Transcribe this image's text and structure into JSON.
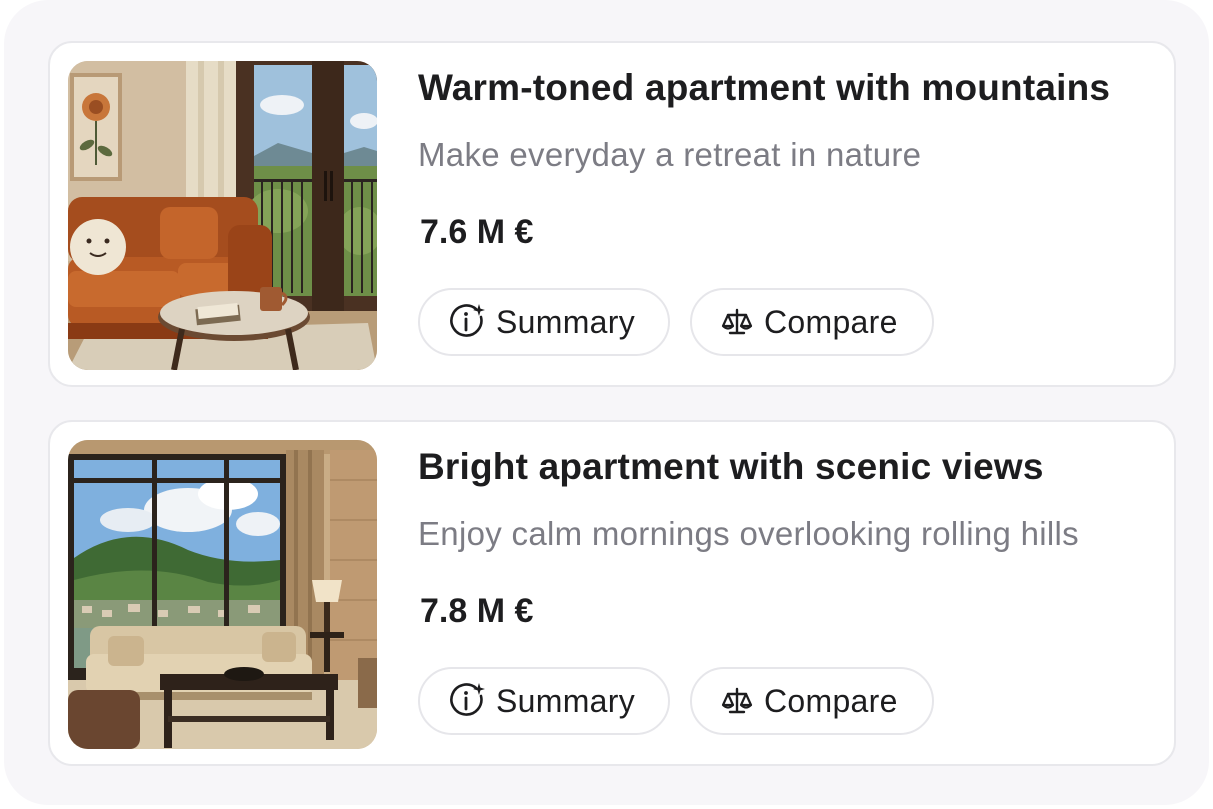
{
  "listings": [
    {
      "title": "Warm-toned apartment with mountains",
      "subtitle": "Make everyday a retreat in nature",
      "price": "7.6 M €",
      "summary_label": "Summary",
      "compare_label": "Compare"
    },
    {
      "title": "Bright apartment with scenic views",
      "subtitle": "Enjoy calm mornings overlooking rolling hills",
      "price": "7.8 M €",
      "summary_label": "Summary",
      "compare_label": "Compare"
    }
  ],
  "icons": {
    "summary": "info-sparkle-icon",
    "compare": "scale-icon"
  },
  "colors": {
    "text_primary": "#1d1d1f",
    "text_secondary": "#7c7c84",
    "border": "#e6e6ea",
    "panel_bg": "#f7f6f9"
  }
}
